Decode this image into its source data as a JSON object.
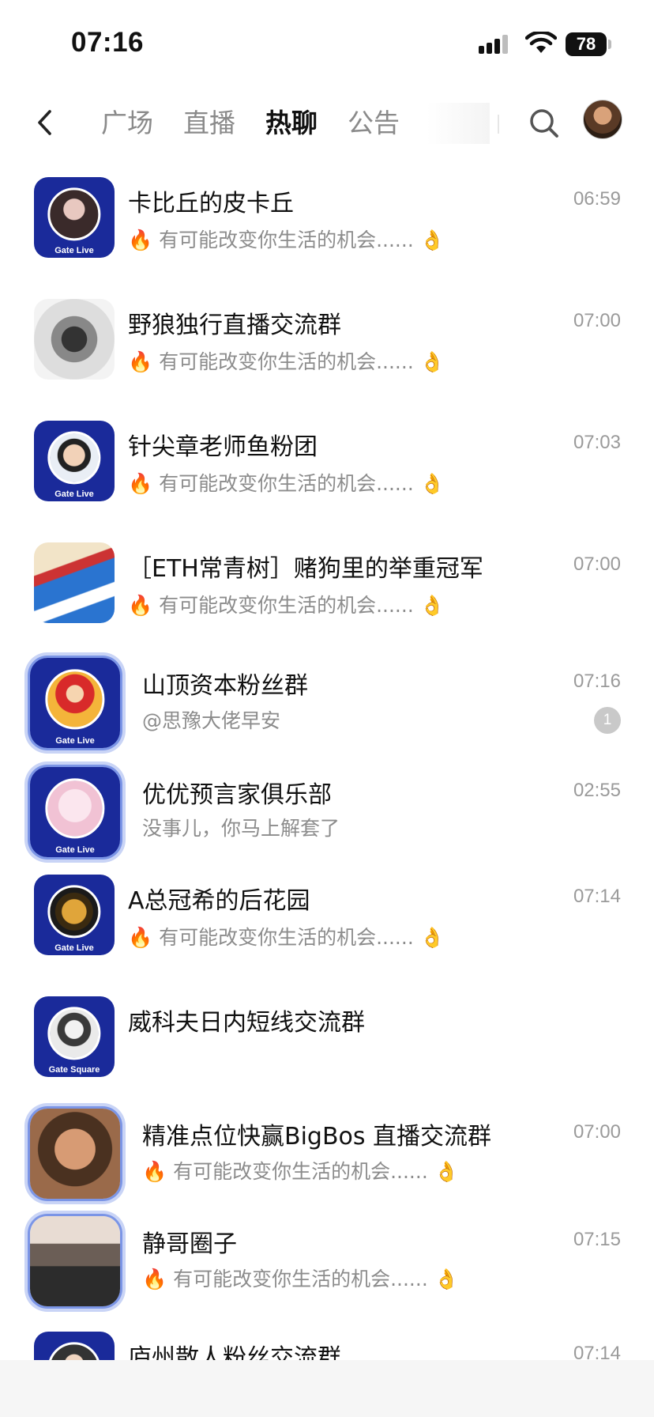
{
  "status": {
    "time": "07:16",
    "battery": "78"
  },
  "nav": {
    "tabs": [
      {
        "label": "广场"
      },
      {
        "label": "直播"
      },
      {
        "label": "热聊",
        "active": true
      },
      {
        "label": "公告"
      }
    ]
  },
  "chats": [
    {
      "name": "卡比丘的皮卡丘",
      "time": "06:59",
      "preview": "有可能改变你生活的机会......",
      "avatar_label": "Gate Live"
    },
    {
      "name": "野狼独行直播交流群",
      "time": "07:00",
      "preview": "有可能改变你生活的机会......"
    },
    {
      "name": "针尖章老师鱼粉团",
      "time": "07:03",
      "preview": "有可能改变你生活的机会......",
      "avatar_label": "Gate Live"
    },
    {
      "name": "［ETH常青树］赌狗里的举重冠军",
      "time": "07:00",
      "preview": "有可能改变你生活的机会......"
    },
    {
      "name": "山顶资本粉丝群",
      "time": "07:16",
      "preview": "@思豫大佬早安",
      "unread": "1",
      "avatar_label": "Gate Live"
    },
    {
      "name": "优优预言家俱乐部",
      "time": "02:55",
      "preview": "没事儿，你马上解套了",
      "avatar_label": "Gate Live"
    },
    {
      "name": "A总冠希的后花园",
      "time": "07:14",
      "preview": "有可能改变你生活的机会......",
      "avatar_label": "Gate Live"
    },
    {
      "name": "威科夫日内短线交流群",
      "avatar_label": "Gate Square"
    },
    {
      "name": "精准点位快赢BigBos 直播交流群",
      "time": "07:00",
      "preview": "有可能改变你生活的机会......"
    },
    {
      "name": "静哥圈子",
      "time": "07:15",
      "preview": "有可能改变你生活的机会......"
    },
    {
      "name": "庐州散人粉丝交流群",
      "time": "07:14"
    }
  ]
}
